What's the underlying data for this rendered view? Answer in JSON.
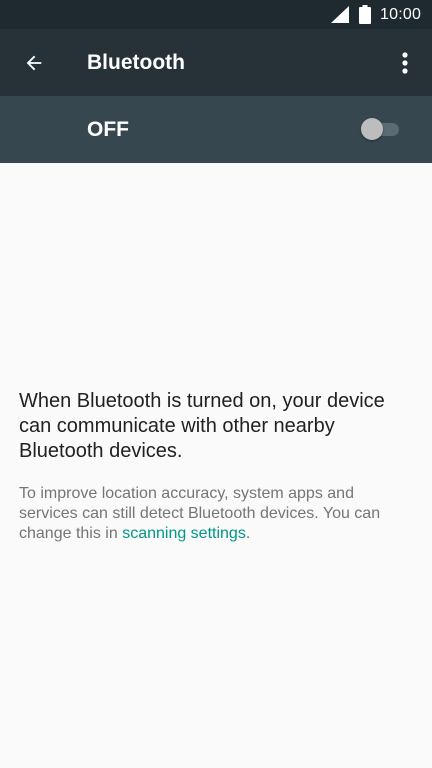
{
  "status_bar": {
    "time": "10:00",
    "signal_icon": "cellular-signal-icon",
    "battery_icon": "battery-icon"
  },
  "app_bar": {
    "title": "Bluetooth",
    "back_icon": "arrow-back-icon",
    "menu_icon": "more-vert-icon"
  },
  "toggle": {
    "label": "OFF",
    "state": "off"
  },
  "content": {
    "main_text": "When Bluetooth is turned on, your device can communicate with other nearby Bluetooth devices.",
    "sub_text_prefix": "To improve location accuracy, system apps and services can still detect Bluetooth devices. You can change this in ",
    "link_text": "scanning settings",
    "sub_text_suffix": "."
  },
  "colors": {
    "status_bar_bg": "#1f2a30",
    "app_bar_bg": "#263238",
    "toggle_row_bg": "#37474f",
    "link": "#009688"
  }
}
